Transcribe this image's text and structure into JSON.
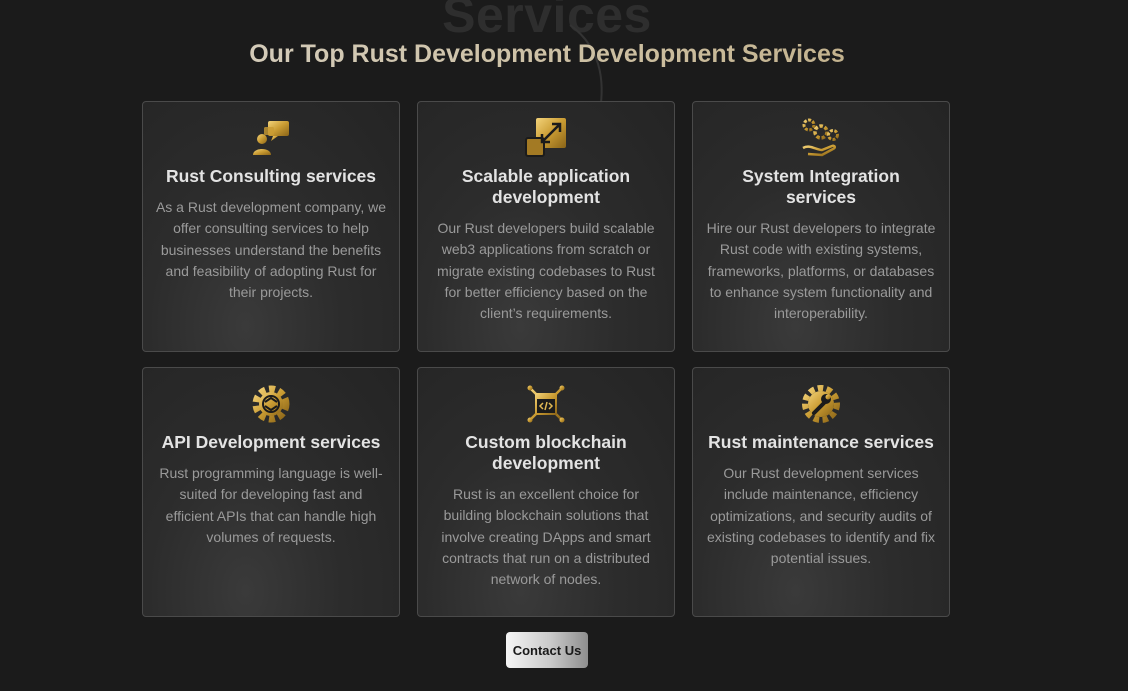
{
  "section": {
    "ghost_heading": "Services",
    "title": "Our Top Rust Development Development Services"
  },
  "colors": {
    "background": "#1b1b1b",
    "gold_accent": "#c9a646",
    "card_border": "#4a4a4a"
  },
  "cards": [
    {
      "icon": "consulting-chat-icon",
      "title": "Rust Consulting services",
      "text": "As a Rust development company, we offer consulting services to help businesses understand the benefits and feasibility of adopting Rust for their projects."
    },
    {
      "icon": "scale-arrows-icon",
      "title": "Scalable application development",
      "text": "Our Rust developers build scalable web3 applications from scratch or migrate existing codebases to Rust for better efficiency based on the client’s requirements."
    },
    {
      "icon": "gears-hand-icon",
      "title": "System Integration services",
      "text": "Hire our Rust developers to integrate Rust code with existing systems, frameworks, platforms, or databases to enhance system functionality and interoperability."
    },
    {
      "icon": "api-gear-icon",
      "title": "API Development services",
      "text": "Rust programming language is well-suited for developing fast and efficient APIs that can handle high volumes of requests."
    },
    {
      "icon": "blockchain-code-icon",
      "title": "Custom blockchain development",
      "text": "Rust is an excellent choice for building blockchain solutions that involve creating DApps and smart contracts that run on a distributed network of nodes."
    },
    {
      "icon": "wrench-gear-icon",
      "title": "Rust maintenance services",
      "text": "Our Rust development services include maintenance, efficiency optimizations, and security audits of existing codebases to identify and fix potential issues."
    }
  ],
  "cta": {
    "label": "Contact Us"
  }
}
